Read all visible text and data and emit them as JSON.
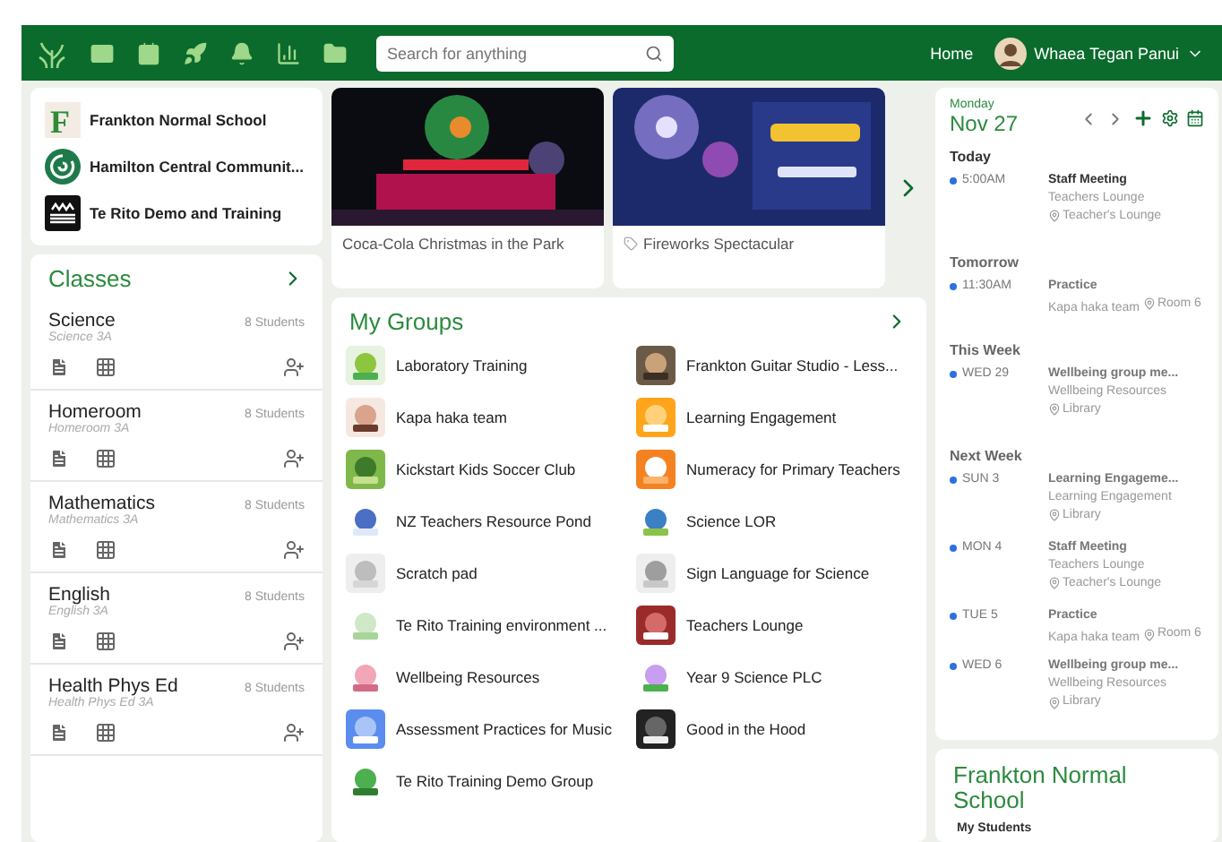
{
  "top_bar": {
    "search": {
      "placeholder": "Search for anything"
    },
    "home_link": "Home",
    "user_name": "Whaea Tegan Panui"
  },
  "schools": [
    {
      "name": "Frankton Normal School",
      "kind": "letter",
      "initial": "F"
    },
    {
      "name": "Hamilton Central Communit...",
      "kind": "swirl"
    },
    {
      "name": "Te Rito Demo and Training",
      "kind": "waves"
    }
  ],
  "classes": {
    "title": "Classes",
    "items": [
      {
        "name": "Science",
        "subtitle": "Science 3A",
        "students": "8 Students"
      },
      {
        "name": "Homeroom",
        "subtitle": "Homeroom 3A",
        "students": "8 Students"
      },
      {
        "name": "Mathematics",
        "subtitle": "Mathematics 3A",
        "students": "8 Students"
      },
      {
        "name": "English",
        "subtitle": "English 3A",
        "students": "8 Students"
      },
      {
        "name": "Health Phys Ed",
        "subtitle": "Health Phys Ed 3A",
        "students": "8 Students"
      }
    ]
  },
  "events": [
    {
      "title": "Coca-Cola Christmas in the Park",
      "tagged": false
    },
    {
      "title": "Fireworks Spectacular",
      "tagged": true
    }
  ],
  "groups": {
    "title": "My Groups",
    "items": [
      {
        "name": "Laboratory Training"
      },
      {
        "name": "Frankton Guitar Studio - Less..."
      },
      {
        "name": "Kapa haka team"
      },
      {
        "name": "Learning Engagement"
      },
      {
        "name": "Kickstart Kids Soccer Club"
      },
      {
        "name": "Numeracy for Primary Teachers"
      },
      {
        "name": "NZ Teachers Resource Pond"
      },
      {
        "name": "Science LOR"
      },
      {
        "name": "Scratch pad"
      },
      {
        "name": "Sign Language for Science"
      },
      {
        "name": "Te Rito Training environment ..."
      },
      {
        "name": "Teachers Lounge"
      },
      {
        "name": "Wellbeing Resources"
      },
      {
        "name": "Year 9 Science PLC"
      },
      {
        "name": "Assessment Practices for Music"
      },
      {
        "name": "Good in the Hood"
      },
      {
        "name": "Te Rito Training Demo Group"
      }
    ]
  },
  "calendar": {
    "weekday": "Monday",
    "date": "Nov 27",
    "sections": [
      {
        "heading": "Today",
        "events": [
          {
            "when": "5:00AM",
            "title": "Staff Meeting",
            "group": "Teachers Lounge",
            "location": "Teacher's Lounge",
            "emphasized": true
          }
        ]
      },
      {
        "heading": "Tomorrow",
        "events": [
          {
            "when": "11:30AM",
            "title": "Practice",
            "group": "Kapa haka team",
            "location": "Room 6",
            "emphasized": false
          }
        ]
      },
      {
        "heading": "This Week",
        "events": [
          {
            "when": "WED 29",
            "title": "Wellbeing group me...",
            "group": "Wellbeing Resources",
            "location": "Library",
            "emphasized": false
          }
        ]
      },
      {
        "heading": "Next Week",
        "events": [
          {
            "when": "SUN 3",
            "title": "Learning Engageme...",
            "group": "Learning Engagement",
            "location": "Library",
            "emphasized": false
          },
          {
            "when": "MON 4",
            "title": "Staff Meeting",
            "group": "Teachers Lounge",
            "location": "Teacher's Lounge",
            "emphasized": false
          },
          {
            "when": "TUE 5",
            "title": "Practice",
            "group": "Kapa haka team",
            "location": "Room 6",
            "emphasized": false
          },
          {
            "when": "WED 6",
            "title": "Wellbeing group me...",
            "group": "Wellbeing Resources",
            "location": "Library",
            "emphasized": false
          }
        ]
      }
    ]
  },
  "school_card": {
    "title": "Frankton Normal School",
    "subheading": "My Students"
  }
}
